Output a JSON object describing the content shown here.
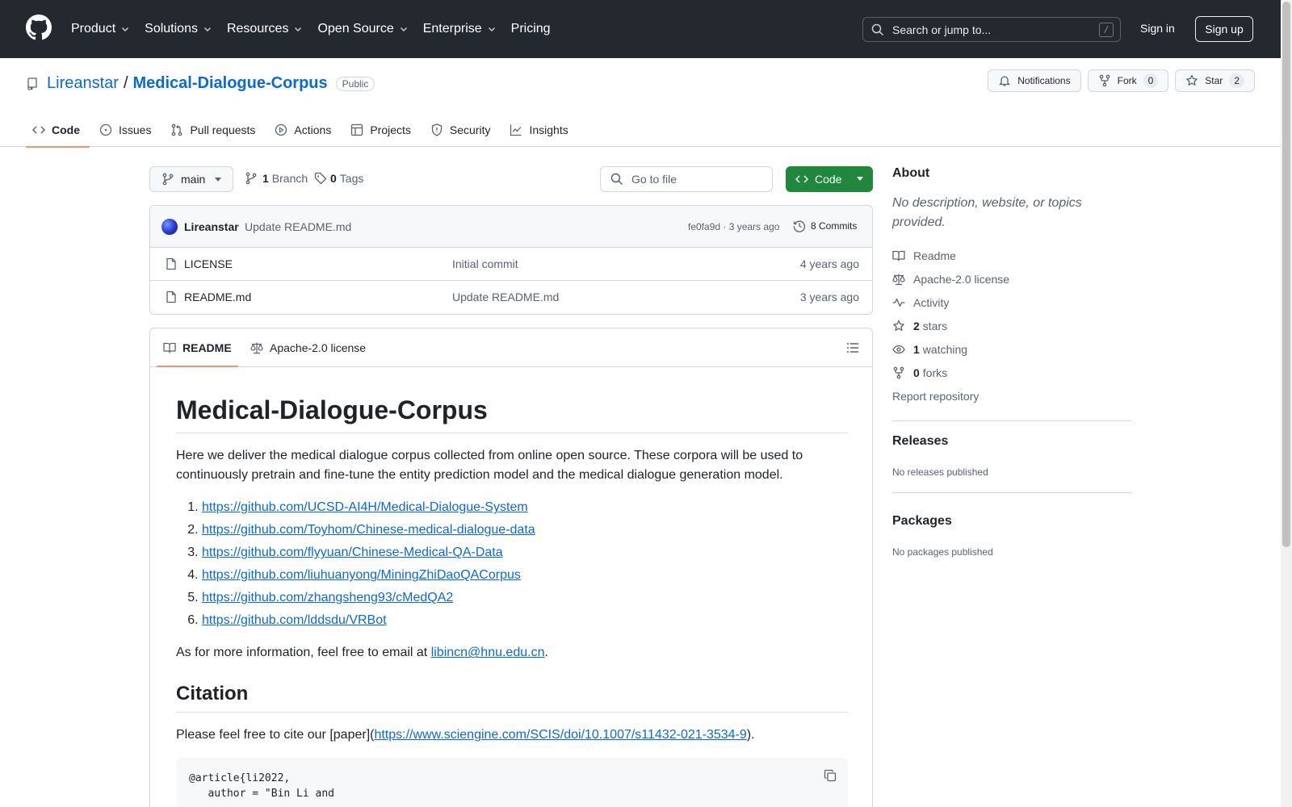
{
  "header": {
    "nav": [
      "Product",
      "Solutions",
      "Resources",
      "Open Source",
      "Enterprise",
      "Pricing"
    ],
    "search_placeholder": "Search or jump to...",
    "search_key": "/",
    "sign_in": "Sign in",
    "sign_up": "Sign up"
  },
  "repo": {
    "owner": "Lireanstar",
    "separator": "/",
    "name": "Medical-Dialogue-Corpus",
    "visibility": "Public",
    "notifications_label": "Notifications",
    "fork_label": "Fork",
    "fork_count": "0",
    "star_label": "Star",
    "star_count": "2"
  },
  "tabs": [
    "Code",
    "Issues",
    "Pull requests",
    "Actions",
    "Projects",
    "Security",
    "Insights"
  ],
  "branch": {
    "current": "main",
    "branch_count": "1",
    "branch_label": "Branch",
    "tag_count": "0",
    "tag_label": "Tags",
    "goto_placeholder": "Go to file",
    "code_label": "Code"
  },
  "commit": {
    "author": "Lireanstar",
    "message": "Update README.md",
    "hash_time": "fe0fa9d · 3 years ago",
    "commits": "8 Commits"
  },
  "files": [
    {
      "name": "LICENSE",
      "message": "Initial commit",
      "time": "4 years ago"
    },
    {
      "name": "README.md",
      "message": "Update README.md",
      "time": "3 years ago"
    }
  ],
  "readme": {
    "tab_readme": "README",
    "tab_license": "Apache-2.0 license",
    "title": "Medical-Dialogue-Corpus",
    "intro": "Here we deliver the medical dialogue corpus collected from online open source. These corpora will be used to continuously pretrain and fine-tune the entity prediction model and the medical dialogue generation model.",
    "links": [
      "https://github.com/UCSD-AI4H/Medical-Dialogue-System",
      "https://github.com/Toyhom/Chinese-medical-dialogue-data",
      "https://github.com/flyyuan/Chinese-Medical-QA-Data",
      "https://github.com/liuhuanyong/MiningZhiDaoQACorpus",
      "https://github.com/zhangsheng93/cMedQA2",
      "https://github.com/lddsdu/VRBot"
    ],
    "email_prefix": "As for more information, feel free to email at ",
    "email": "libincn@hnu.edu.cn",
    "email_suffix": ".",
    "citation_heading": "Citation",
    "cite_prefix": "Please feel free to cite our [paper](",
    "cite_link": "https://www.sciengine.com/SCIS/doi/10.1007/s11432-021-3534-9",
    "cite_suffix": ").",
    "code_line1": "@article{li2022,",
    "code_line2": "   author = \"Bin Li and"
  },
  "about": {
    "heading": "About",
    "description": "No description, website, or topics provided.",
    "readme": "Readme",
    "license": "Apache-2.0 license",
    "activity": "Activity",
    "stars_count": "2",
    "stars_label": "stars",
    "watching_count": "1",
    "watching_label": "watching",
    "forks_count": "0",
    "forks_label": "forks",
    "report": "Report repository"
  },
  "releases": {
    "heading": "Releases",
    "empty": "No releases published"
  },
  "packages": {
    "heading": "Packages",
    "empty": "No packages published"
  },
  "colors": {
    "header_bg": "#24292f",
    "link": "#0969da",
    "green": "#1f883d",
    "tab_underline": "#fd8c73"
  }
}
